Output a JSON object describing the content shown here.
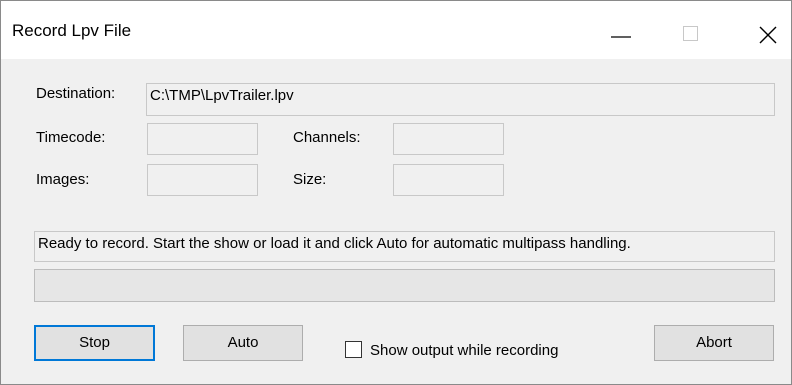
{
  "window": {
    "title": "Record Lpv File"
  },
  "titlebar_buttons": {
    "minimize_icon": "minimize-icon",
    "maximize_icon": "maximize-icon",
    "close_icon": "close-icon"
  },
  "form": {
    "destination_label": "Destination:",
    "destination_value": "C:\\TMP\\LpvTrailer.lpv",
    "timecode_label": "Timecode:",
    "timecode_value": "",
    "channels_label": "Channels:",
    "channels_value": "",
    "images_label": "Images:",
    "images_value": "",
    "size_label": "Size:",
    "size_value": ""
  },
  "status": {
    "message": "Ready to record.  Start the show or load it and click Auto for automatic multipass handling.",
    "progress_percent": 0
  },
  "buttons": {
    "stop": "Stop",
    "auto": "Auto",
    "abort": "Abort"
  },
  "options": {
    "show_output_label": "Show output while recording",
    "show_output_checked": false
  },
  "colors": {
    "accent": "#0078d7",
    "window_bg": "#f0f0f0",
    "progress_fill": "#06b025"
  }
}
